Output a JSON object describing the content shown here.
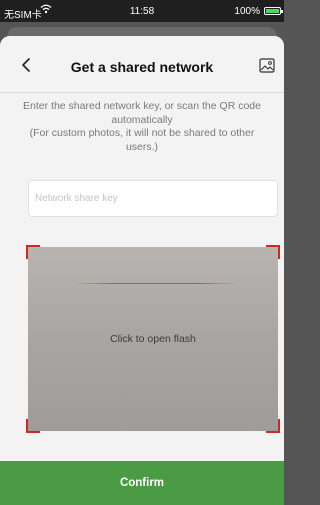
{
  "status_bar": {
    "carrier": "无SIM卡",
    "wifi_icon": "wifi-icon",
    "time": "11:58",
    "battery": "100%",
    "battery_icon": "battery-icon",
    "battery_color": "#4cd964"
  },
  "header": {
    "title": "Get a shared network",
    "back_icon": "chevron-left-icon",
    "gallery_icon": "image-icon"
  },
  "instructions": [
    "Enter the shared network key, or scan the QR code automatically",
    "(For custom photos, it will not be shared to other users.)"
  ],
  "key_input": {
    "placeholder": "Network share key",
    "value": ""
  },
  "scanner": {
    "flash_label": "Click to open flash",
    "corner_color": "#cc2a1f"
  },
  "confirm": {
    "label": "Confirm",
    "color": "#4b9a44"
  }
}
